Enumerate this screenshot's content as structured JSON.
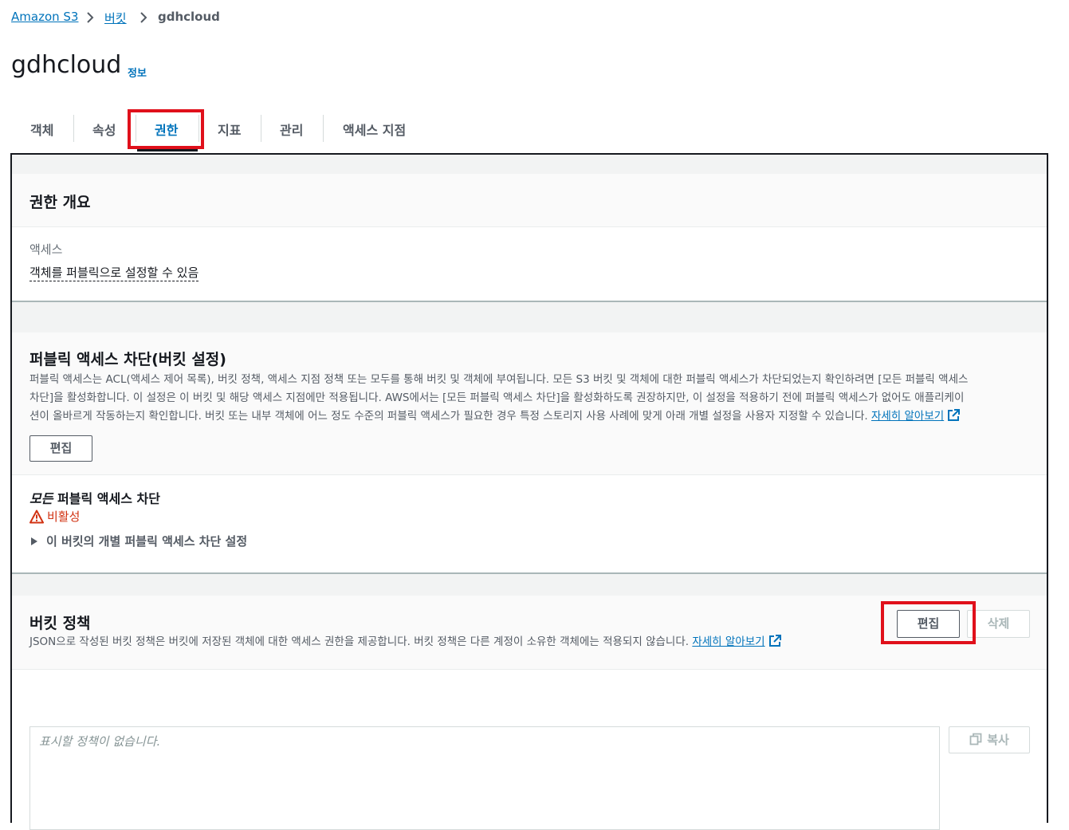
{
  "breadcrumb": {
    "items": [
      "Amazon S3",
      "버킷"
    ],
    "current": "gdhcloud"
  },
  "page": {
    "title": "gdhcloud",
    "info_link": "정보"
  },
  "tabs": [
    {
      "label": "객체",
      "active": false
    },
    {
      "label": "속성",
      "active": false
    },
    {
      "label": "권한",
      "active": true
    },
    {
      "label": "지표",
      "active": false
    },
    {
      "label": "관리",
      "active": false
    },
    {
      "label": "액세스 지점",
      "active": false
    }
  ],
  "overview": {
    "title": "권한 개요",
    "access_label": "액세스",
    "access_value": "객체를 퍼블릭으로 설정할 수 있음"
  },
  "block_public": {
    "title": "퍼블릭 액세스 차단(버킷 설정)",
    "description_line1": "퍼블릭 액세스는 ACL(액세스 제어 목록), 버킷 정책, 액세스 지점 정책 또는 모두를 통해 버킷 및 객체에 부여됩니다. 모든 S3 버킷 및 객체에 대한 퍼블릭 액세스가 차단되었는지 확인하려면 [모든 퍼블릭 액세스",
    "description_line2": "차단]을 활성화합니다. 이 설정은 이 버킷 및 해당 액세스 지점에만 적용됩니다. AWS에서는 [모든 퍼블릭 액세스 차단]을 활성화하도록 권장하지만, 이 설정을 적용하기 전에 퍼블릭 액세스가 없어도 애플리케이",
    "description_line3": "션이 올바르게 작동하는지 확인합니다. 버킷 또는 내부 객체에 어느 정도 수준의 퍼블릭 액세스가 필요한 경우 특정 스토리지 사용 사례에 맞게 아래 개별 설정을 사용자 지정할 수 있습니다.",
    "learn_more": "자세히 알아보기",
    "edit_button": "편집",
    "setting_title_italic": "모든",
    "setting_title_rest": " 퍼블릭 액세스 차단",
    "status": "비활성",
    "expand_label": "이 버킷의 개별 퍼블릭 액세스 차단 설정"
  },
  "bucket_policy": {
    "title": "버킷 정책",
    "description": "JSON으로 작성된 버킷 정책은 버킷에 저장된 객체에 대한 액세스 권한을 제공합니다. 버킷 정책은 다른 계정이 소유한 객체에는 적용되지 않습니다.",
    "learn_more": "자세히 알아보기",
    "edit_button": "편집",
    "delete_button": "삭제",
    "placeholder": "표시할 정책이 없습니다.",
    "copy_button": "복사"
  },
  "colors": {
    "link": "#0073bb",
    "highlight": "#e0101b",
    "warning": "#d13212"
  }
}
